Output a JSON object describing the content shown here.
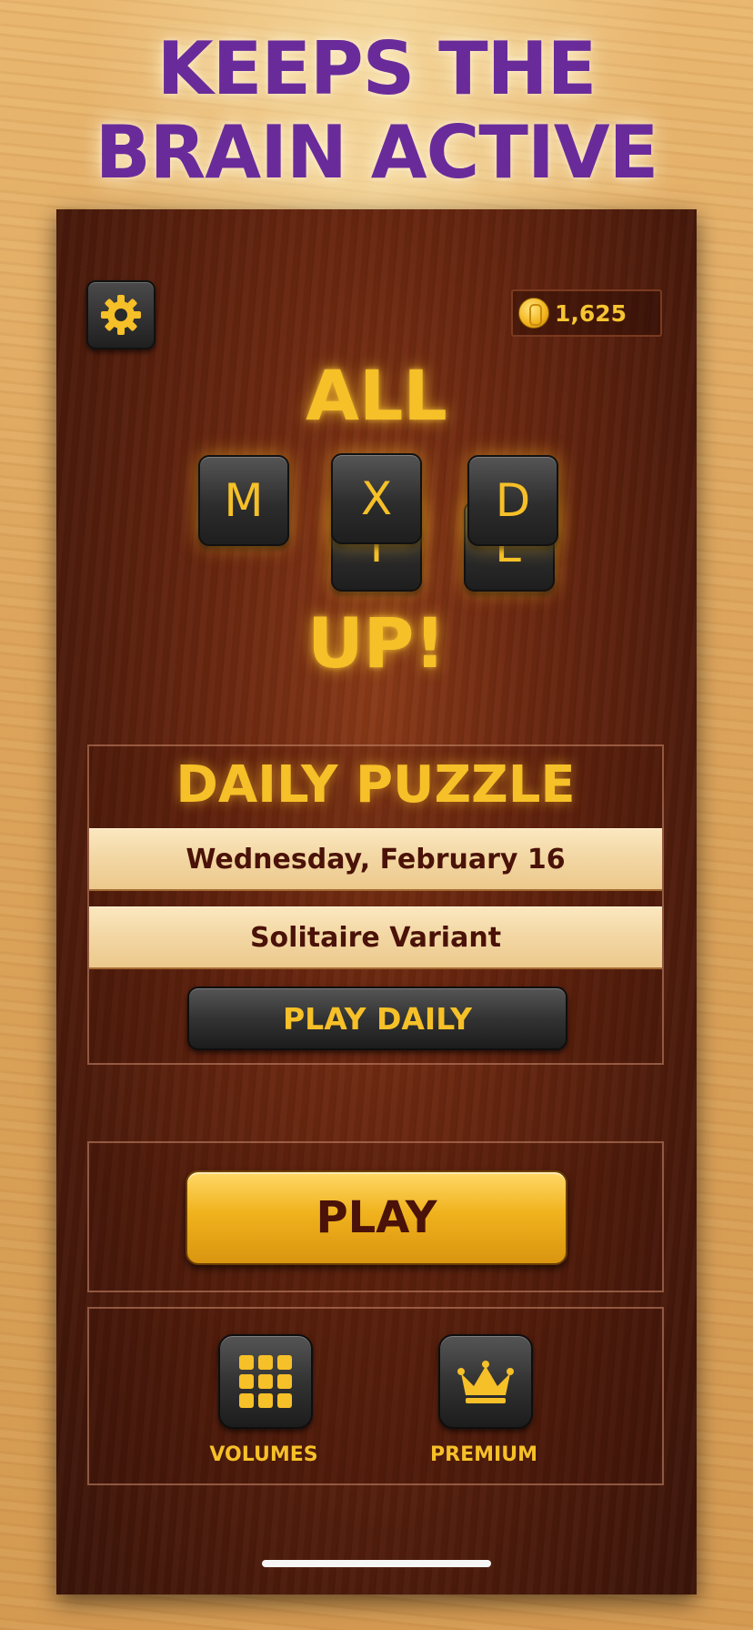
{
  "promo": {
    "headline_line1": "KEEPS THE",
    "headline_line2": "BRAIN ACTIVE"
  },
  "header": {
    "coins": "1,625",
    "settings_icon": "gear-icon",
    "coin_icon": "coin-icon"
  },
  "logo": {
    "word_top": "ALL",
    "tiles": [
      "M",
      "I",
      "X",
      "E",
      "D"
    ],
    "word_bottom": "UP!"
  },
  "daily": {
    "title": "DAILY PUZZLE",
    "date": "Wednesday, February 16",
    "variant": "Solitaire Variant",
    "play_label": "PLAY DAILY"
  },
  "main": {
    "play_label": "PLAY"
  },
  "bottom": {
    "volumes_label": "VOLUMES",
    "volumes_icon": "grid-icon",
    "premium_label": "PREMIUM",
    "premium_icon": "crown-icon"
  },
  "colors": {
    "accent_gold": "#f6c028",
    "promo_purple": "#6a2b9a",
    "wood_dark": "#4a1a0b",
    "text_dark": "#4a1208"
  }
}
